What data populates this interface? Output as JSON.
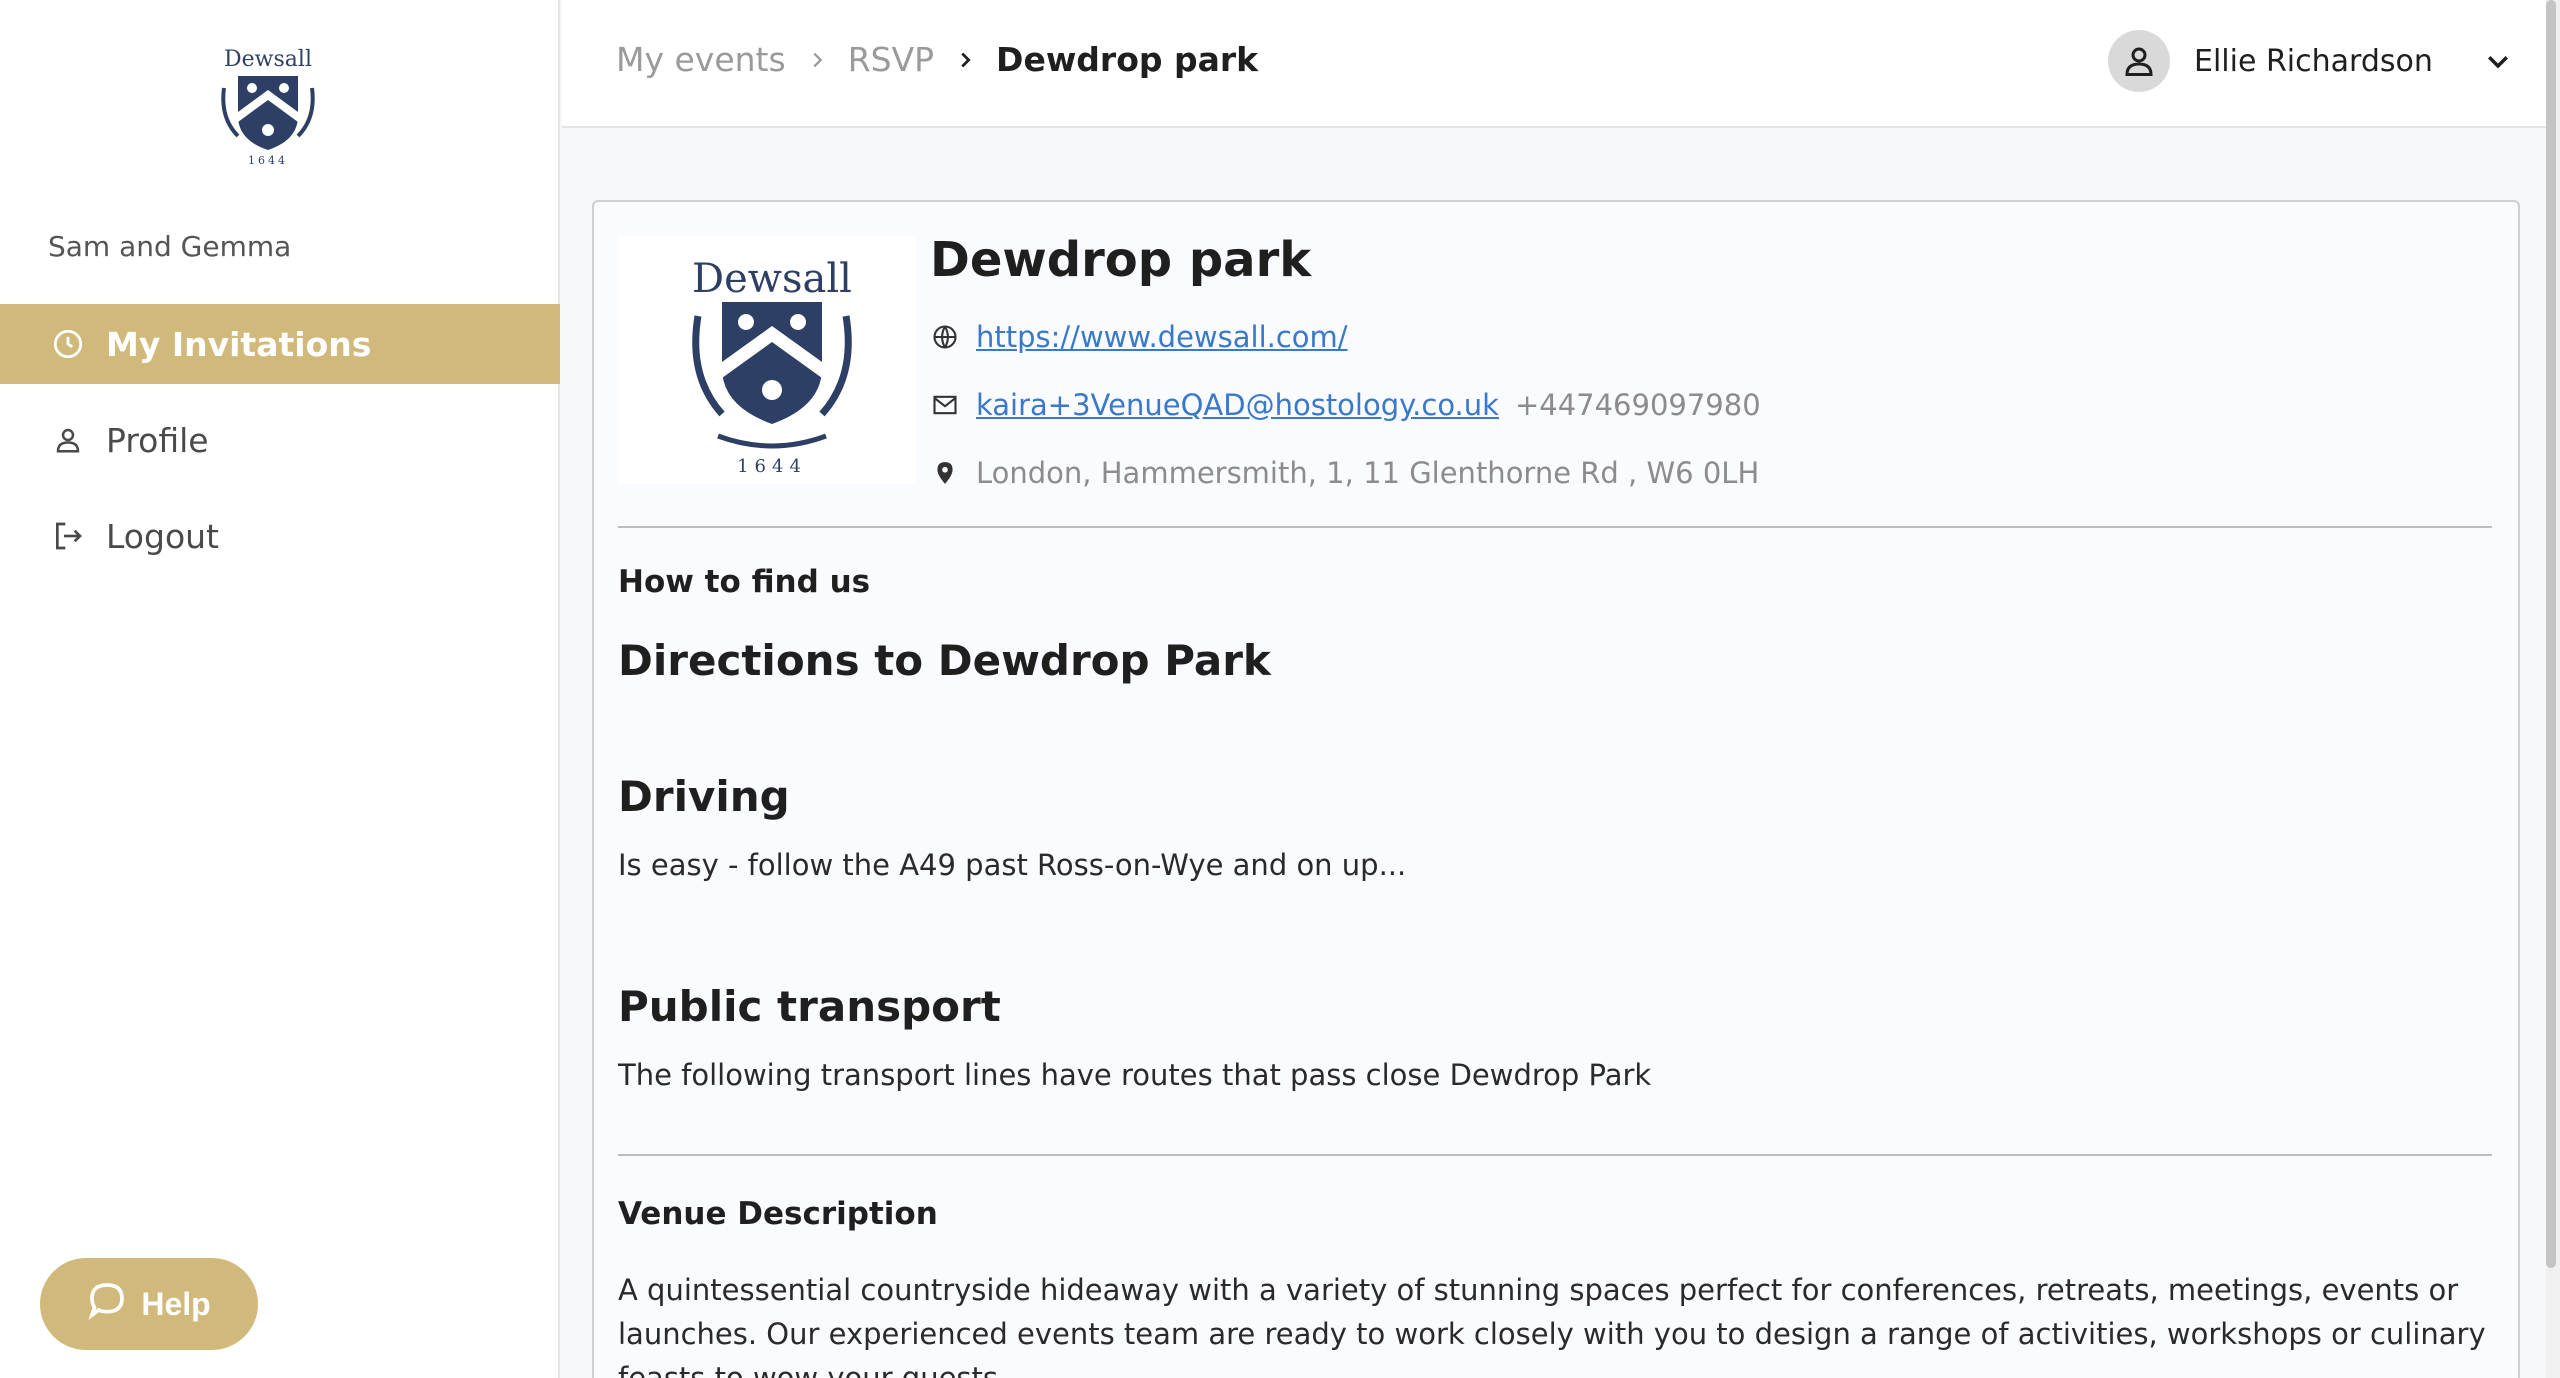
{
  "sidebar": {
    "logo_icon": "dewsall-crest-logo",
    "couple_name": "Sam and Gemma",
    "items": [
      {
        "label": "My Invitations",
        "icon": "clock-icon",
        "active": true
      },
      {
        "label": "Profile",
        "icon": "person-icon",
        "active": false
      },
      {
        "label": "Logout",
        "icon": "logout-icon",
        "active": false
      }
    ],
    "help_label": "Help",
    "help_icon": "chat-bubble-icon"
  },
  "header": {
    "breadcrumbs": [
      "My events",
      "RSVP",
      "Dewdrop park"
    ],
    "user_name": "Ellie Richardson"
  },
  "venue": {
    "name": "Dewdrop park",
    "website": "https://www.dewsall.com/",
    "email": "kaira+3VenueQAD@hostology.co.uk",
    "phone": "+447469097980",
    "address": "London, Hammersmith, 1, 11 Glenthorne Rd , W6 0LH",
    "logo_text": "Dewsall",
    "logo_year": "1644"
  },
  "directions": {
    "section_title": "How to find us",
    "title": "Directions to Dewdrop Park",
    "driving_title": "Driving",
    "driving_text": "Is easy - follow the A49 past Ross-on-Wye and on up...",
    "transport_title": "Public transport",
    "transport_text": "The following transport lines have routes that pass close Dewdrop Park"
  },
  "description": {
    "title": "Venue Description",
    "text": "A quintessential countryside hideaway with a variety of stunning spaces perfect for conferences, retreats, meetings, events or launches. Our experienced events team are ready to work closely with you to design a range of activities, workshops or culinary feasts to wow your guests."
  },
  "colors": {
    "accent": "#d0b97a",
    "link": "#3a78c9",
    "crest": "#2e3f66"
  }
}
